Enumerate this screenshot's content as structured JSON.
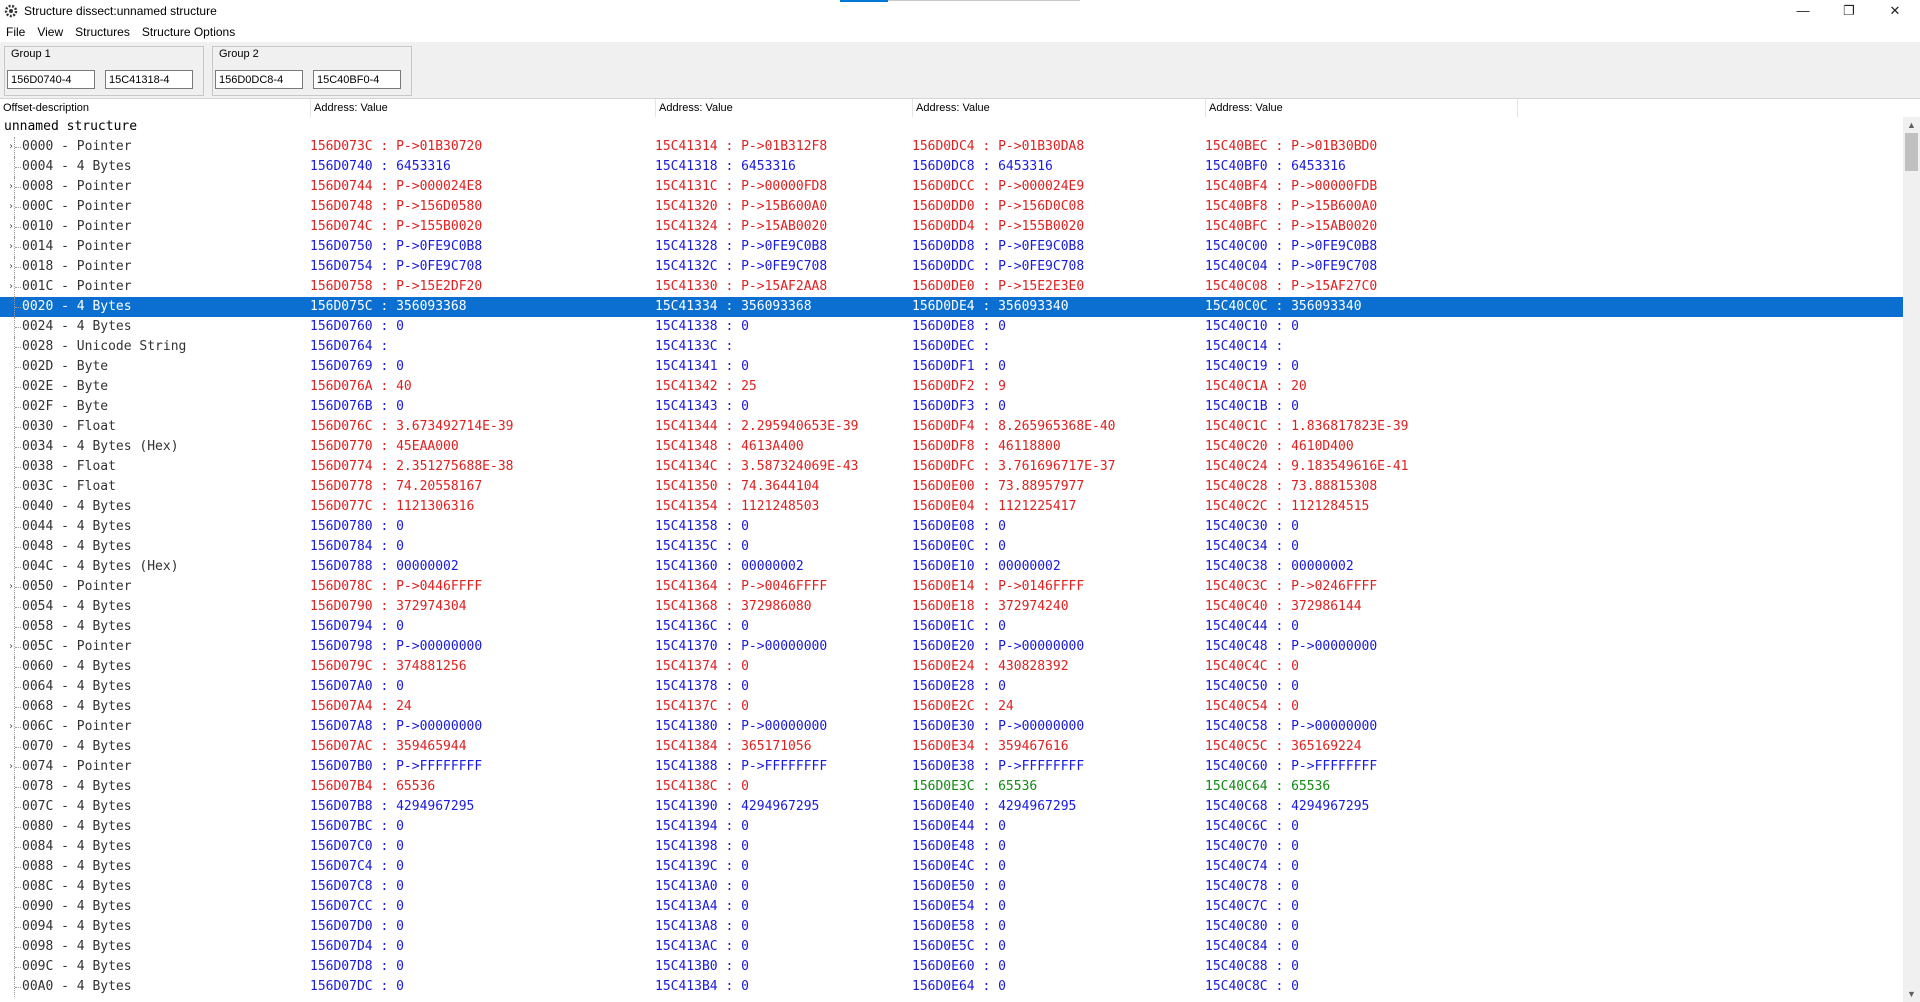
{
  "window": {
    "title": "Structure dissect:unnamed structure",
    "minimize": "—",
    "restore": "❐",
    "close": "✕"
  },
  "menu": [
    "File",
    "View",
    "Structures",
    "Structure Options"
  ],
  "groups": [
    {
      "title": "Group 1",
      "addresses": [
        "156D0740-4",
        "15C41318-4"
      ]
    },
    {
      "title": "Group 2",
      "addresses": [
        "156D0DC8-4",
        "15C40BF0-4"
      ]
    }
  ],
  "columns": [
    "Offset-description",
    "Address: Value",
    "Address: Value",
    "Address: Value",
    "Address: Value"
  ],
  "root_label": "unnamed structure",
  "colors": {
    "red": "#e02020",
    "blue": "#1a1ae0",
    "green": "#128a12",
    "selection": "#0a6fd1"
  },
  "rows": [
    {
      "offset": "0000",
      "type": "Pointer",
      "exp": true,
      "cells": [
        [
          "156D073C",
          "P->01B30720",
          "r"
        ],
        [
          "15C41314",
          "P->01B312F8",
          "r"
        ],
        [
          "156D0DC4",
          "P->01B30DA8",
          "r"
        ],
        [
          "15C40BEC",
          "P->01B30BD0",
          "r"
        ]
      ]
    },
    {
      "offset": "0004",
      "type": "4 Bytes",
      "exp": false,
      "cells": [
        [
          "156D0740",
          "6453316",
          "b"
        ],
        [
          "15C41318",
          "6453316",
          "b"
        ],
        [
          "156D0DC8",
          "6453316",
          "b"
        ],
        [
          "15C40BF0",
          "6453316",
          "b"
        ]
      ]
    },
    {
      "offset": "0008",
      "type": "Pointer",
      "exp": true,
      "cells": [
        [
          "156D0744",
          "P->000024E8",
          "r"
        ],
        [
          "15C4131C",
          "P->00000FD8",
          "r"
        ],
        [
          "156D0DCC",
          "P->000024E9",
          "r"
        ],
        [
          "15C40BF4",
          "P->00000FDB",
          "r"
        ]
      ]
    },
    {
      "offset": "000C",
      "type": "Pointer",
      "exp": true,
      "cells": [
        [
          "156D0748",
          "P->156D0580",
          "r"
        ],
        [
          "15C41320",
          "P->15B600A0",
          "r"
        ],
        [
          "156D0DD0",
          "P->156D0C08",
          "r"
        ],
        [
          "15C40BF8",
          "P->15B600A0",
          "r"
        ]
      ]
    },
    {
      "offset": "0010",
      "type": "Pointer",
      "exp": true,
      "cells": [
        [
          "156D074C",
          "P->155B0020",
          "r"
        ],
        [
          "15C41324",
          "P->15AB0020",
          "r"
        ],
        [
          "156D0DD4",
          "P->155B0020",
          "r"
        ],
        [
          "15C40BFC",
          "P->15AB0020",
          "r"
        ]
      ]
    },
    {
      "offset": "0014",
      "type": "Pointer",
      "exp": true,
      "cells": [
        [
          "156D0750",
          "P->0FE9C0B8",
          "b"
        ],
        [
          "15C41328",
          "P->0FE9C0B8",
          "b"
        ],
        [
          "156D0DD8",
          "P->0FE9C0B8",
          "b"
        ],
        [
          "15C40C00",
          "P->0FE9C0B8",
          "b"
        ]
      ]
    },
    {
      "offset": "0018",
      "type": "Pointer",
      "exp": true,
      "cells": [
        [
          "156D0754",
          "P->0FE9C708",
          "b"
        ],
        [
          "15C4132C",
          "P->0FE9C708",
          "b"
        ],
        [
          "156D0DDC",
          "P->0FE9C708",
          "b"
        ],
        [
          "15C40C04",
          "P->0FE9C708",
          "b"
        ]
      ]
    },
    {
      "offset": "001C",
      "type": "Pointer",
      "exp": true,
      "cells": [
        [
          "156D0758",
          "P->15E2DF20",
          "r"
        ],
        [
          "15C41330",
          "P->15AF2AA8",
          "r"
        ],
        [
          "156D0DE0",
          "P->15E2E3E0",
          "r"
        ],
        [
          "15C40C08",
          "P->15AF27C0",
          "r"
        ]
      ]
    },
    {
      "offset": "0020",
      "type": "4 Bytes",
      "exp": false,
      "selected": true,
      "cells": [
        [
          "156D075C",
          "356093368",
          "r"
        ],
        [
          "15C41334",
          "356093368",
          "r"
        ],
        [
          "156D0DE4",
          "356093340",
          "r"
        ],
        [
          "15C40C0C",
          "356093340",
          "r"
        ]
      ]
    },
    {
      "offset": "0024",
      "type": "4 Bytes",
      "exp": false,
      "cells": [
        [
          "156D0760",
          "0",
          "b"
        ],
        [
          "15C41338",
          "0",
          "b"
        ],
        [
          "156D0DE8",
          "0",
          "b"
        ],
        [
          "15C40C10",
          "0",
          "b"
        ]
      ]
    },
    {
      "offset": "0028",
      "type": "Unicode String",
      "exp": false,
      "cells": [
        [
          "156D0764",
          "",
          "b"
        ],
        [
          "15C4133C",
          "",
          "b"
        ],
        [
          "156D0DEC",
          "",
          "b"
        ],
        [
          "15C40C14",
          "",
          "b"
        ]
      ]
    },
    {
      "offset": "002D",
      "type": "Byte",
      "exp": false,
      "cells": [
        [
          "156D0769",
          "0",
          "b"
        ],
        [
          "15C41341",
          "0",
          "b"
        ],
        [
          "156D0DF1",
          "0",
          "b"
        ],
        [
          "15C40C19",
          "0",
          "b"
        ]
      ]
    },
    {
      "offset": "002E",
      "type": "Byte",
      "exp": false,
      "cells": [
        [
          "156D076A",
          "40",
          "r"
        ],
        [
          "15C41342",
          "25",
          "r"
        ],
        [
          "156D0DF2",
          "9",
          "r"
        ],
        [
          "15C40C1A",
          "20",
          "r"
        ]
      ]
    },
    {
      "offset": "002F",
      "type": "Byte",
      "exp": false,
      "cells": [
        [
          "156D076B",
          "0",
          "b"
        ],
        [
          "15C41343",
          "0",
          "b"
        ],
        [
          "156D0DF3",
          "0",
          "b"
        ],
        [
          "15C40C1B",
          "0",
          "b"
        ]
      ]
    },
    {
      "offset": "0030",
      "type": "Float",
      "exp": false,
      "cells": [
        [
          "156D076C",
          "3.673492714E-39",
          "r"
        ],
        [
          "15C41344",
          "2.295940653E-39",
          "r"
        ],
        [
          "156D0DF4",
          "8.265965368E-40",
          "r"
        ],
        [
          "15C40C1C",
          "1.836817823E-39",
          "r"
        ]
      ]
    },
    {
      "offset": "0034",
      "type": "4 Bytes (Hex)",
      "exp": false,
      "cells": [
        [
          "156D0770",
          "45EAA000",
          "r"
        ],
        [
          "15C41348",
          "4613A400",
          "r"
        ],
        [
          "156D0DF8",
          "46118800",
          "r"
        ],
        [
          "15C40C20",
          "4610D400",
          "r"
        ]
      ]
    },
    {
      "offset": "0038",
      "type": "Float",
      "exp": false,
      "cells": [
        [
          "156D0774",
          "2.351275688E-38",
          "r"
        ],
        [
          "15C4134C",
          "3.587324069E-43",
          "r"
        ],
        [
          "156D0DFC",
          "3.761696717E-37",
          "r"
        ],
        [
          "15C40C24",
          "9.183549616E-41",
          "r"
        ]
      ]
    },
    {
      "offset": "003C",
      "type": "Float",
      "exp": false,
      "cells": [
        [
          "156D0778",
          "74.20558167",
          "r"
        ],
        [
          "15C41350",
          "74.3644104",
          "r"
        ],
        [
          "156D0E00",
          "73.88957977",
          "r"
        ],
        [
          "15C40C28",
          "73.88815308",
          "r"
        ]
      ]
    },
    {
      "offset": "0040",
      "type": "4 Bytes",
      "exp": false,
      "cells": [
        [
          "156D077C",
          "1121306316",
          "r"
        ],
        [
          "15C41354",
          "1121248503",
          "r"
        ],
        [
          "156D0E04",
          "1121225417",
          "r"
        ],
        [
          "15C40C2C",
          "1121284515",
          "r"
        ]
      ]
    },
    {
      "offset": "0044",
      "type": "4 Bytes",
      "exp": false,
      "cells": [
        [
          "156D0780",
          "0",
          "b"
        ],
        [
          "15C41358",
          "0",
          "b"
        ],
        [
          "156D0E08",
          "0",
          "b"
        ],
        [
          "15C40C30",
          "0",
          "b"
        ]
      ]
    },
    {
      "offset": "0048",
      "type": "4 Bytes",
      "exp": false,
      "cells": [
        [
          "156D0784",
          "0",
          "b"
        ],
        [
          "15C4135C",
          "0",
          "b"
        ],
        [
          "156D0E0C",
          "0",
          "b"
        ],
        [
          "15C40C34",
          "0",
          "b"
        ]
      ]
    },
    {
      "offset": "004C",
      "type": "4 Bytes (Hex)",
      "exp": false,
      "cells": [
        [
          "156D0788",
          "00000002",
          "b"
        ],
        [
          "15C41360",
          "00000002",
          "b"
        ],
        [
          "156D0E10",
          "00000002",
          "b"
        ],
        [
          "15C40C38",
          "00000002",
          "b"
        ]
      ]
    },
    {
      "offset": "0050",
      "type": "Pointer",
      "exp": true,
      "cells": [
        [
          "156D078C",
          "P->0446FFFF",
          "r"
        ],
        [
          "15C41364",
          "P->0046FFFF",
          "r"
        ],
        [
          "156D0E14",
          "P->0146FFFF",
          "r"
        ],
        [
          "15C40C3C",
          "P->0246FFFF",
          "r"
        ]
      ]
    },
    {
      "offset": "0054",
      "type": "4 Bytes",
      "exp": false,
      "cells": [
        [
          "156D0790",
          "372974304",
          "r"
        ],
        [
          "15C41368",
          "372986080",
          "r"
        ],
        [
          "156D0E18",
          "372974240",
          "r"
        ],
        [
          "15C40C40",
          "372986144",
          "r"
        ]
      ]
    },
    {
      "offset": "0058",
      "type": "4 Bytes",
      "exp": false,
      "cells": [
        [
          "156D0794",
          "0",
          "b"
        ],
        [
          "15C4136C",
          "0",
          "b"
        ],
        [
          "156D0E1C",
          "0",
          "b"
        ],
        [
          "15C40C44",
          "0",
          "b"
        ]
      ]
    },
    {
      "offset": "005C",
      "type": "Pointer",
      "exp": true,
      "cells": [
        [
          "156D0798",
          "P->00000000",
          "b"
        ],
        [
          "15C41370",
          "P->00000000",
          "b"
        ],
        [
          "156D0E20",
          "P->00000000",
          "b"
        ],
        [
          "15C40C48",
          "P->00000000",
          "b"
        ]
      ]
    },
    {
      "offset": "0060",
      "type": "4 Bytes",
      "exp": false,
      "cells": [
        [
          "156D079C",
          "374881256",
          "r"
        ],
        [
          "15C41374",
          "0",
          "r"
        ],
        [
          "156D0E24",
          "430828392",
          "r"
        ],
        [
          "15C40C4C",
          "0",
          "r"
        ]
      ]
    },
    {
      "offset": "0064",
      "type": "4 Bytes",
      "exp": false,
      "cells": [
        [
          "156D07A0",
          "0",
          "b"
        ],
        [
          "15C41378",
          "0",
          "b"
        ],
        [
          "156D0E28",
          "0",
          "b"
        ],
        [
          "15C40C50",
          "0",
          "b"
        ]
      ]
    },
    {
      "offset": "0068",
      "type": "4 Bytes",
      "exp": false,
      "cells": [
        [
          "156D07A4",
          "24",
          "r"
        ],
        [
          "15C4137C",
          "0",
          "r"
        ],
        [
          "156D0E2C",
          "24",
          "r"
        ],
        [
          "15C40C54",
          "0",
          "r"
        ]
      ]
    },
    {
      "offset": "006C",
      "type": "Pointer",
      "exp": true,
      "cells": [
        [
          "156D07A8",
          "P->00000000",
          "b"
        ],
        [
          "15C41380",
          "P->00000000",
          "b"
        ],
        [
          "156D0E30",
          "P->00000000",
          "b"
        ],
        [
          "15C40C58",
          "P->00000000",
          "b"
        ]
      ]
    },
    {
      "offset": "0070",
      "type": "4 Bytes",
      "exp": false,
      "cells": [
        [
          "156D07AC",
          "359465944",
          "r"
        ],
        [
          "15C41384",
          "365171056",
          "r"
        ],
        [
          "156D0E34",
          "359467616",
          "r"
        ],
        [
          "15C40C5C",
          "365169224",
          "r"
        ]
      ]
    },
    {
      "offset": "0074",
      "type": "Pointer",
      "exp": true,
      "cells": [
        [
          "156D07B0",
          "P->FFFFFFFF",
          "b"
        ],
        [
          "15C41388",
          "P->FFFFFFFF",
          "b"
        ],
        [
          "156D0E38",
          "P->FFFFFFFF",
          "b"
        ],
        [
          "15C40C60",
          "P->FFFFFFFF",
          "b"
        ]
      ]
    },
    {
      "offset": "0078",
      "type": "4 Bytes",
      "exp": false,
      "cells": [
        [
          "156D07B4",
          "65536",
          "r"
        ],
        [
          "15C4138C",
          "0",
          "r"
        ],
        [
          "156D0E3C",
          "65536",
          "g"
        ],
        [
          "15C40C64",
          "65536",
          "g"
        ]
      ]
    },
    {
      "offset": "007C",
      "type": "4 Bytes",
      "exp": false,
      "cells": [
        [
          "156D07B8",
          "4294967295",
          "b"
        ],
        [
          "15C41390",
          "4294967295",
          "b"
        ],
        [
          "156D0E40",
          "4294967295",
          "b"
        ],
        [
          "15C40C68",
          "4294967295",
          "b"
        ]
      ]
    },
    {
      "offset": "0080",
      "type": "4 Bytes",
      "exp": false,
      "cells": [
        [
          "156D07BC",
          "0",
          "b"
        ],
        [
          "15C41394",
          "0",
          "b"
        ],
        [
          "156D0E44",
          "0",
          "b"
        ],
        [
          "15C40C6C",
          "0",
          "b"
        ]
      ]
    },
    {
      "offset": "0084",
      "type": "4 Bytes",
      "exp": false,
      "cells": [
        [
          "156D07C0",
          "0",
          "b"
        ],
        [
          "15C41398",
          "0",
          "b"
        ],
        [
          "156D0E48",
          "0",
          "b"
        ],
        [
          "15C40C70",
          "0",
          "b"
        ]
      ]
    },
    {
      "offset": "0088",
      "type": "4 Bytes",
      "exp": false,
      "cells": [
        [
          "156D07C4",
          "0",
          "b"
        ],
        [
          "15C4139C",
          "0",
          "b"
        ],
        [
          "156D0E4C",
          "0",
          "b"
        ],
        [
          "15C40C74",
          "0",
          "b"
        ]
      ]
    },
    {
      "offset": "008C",
      "type": "4 Bytes",
      "exp": false,
      "cells": [
        [
          "156D07C8",
          "0",
          "b"
        ],
        [
          "15C413A0",
          "0",
          "b"
        ],
        [
          "156D0E50",
          "0",
          "b"
        ],
        [
          "15C40C78",
          "0",
          "b"
        ]
      ]
    },
    {
      "offset": "0090",
      "type": "4 Bytes",
      "exp": false,
      "cells": [
        [
          "156D07CC",
          "0",
          "b"
        ],
        [
          "15C413A4",
          "0",
          "b"
        ],
        [
          "156D0E54",
          "0",
          "b"
        ],
        [
          "15C40C7C",
          "0",
          "b"
        ]
      ]
    },
    {
      "offset": "0094",
      "type": "4 Bytes",
      "exp": false,
      "cells": [
        [
          "156D07D0",
          "0",
          "b"
        ],
        [
          "15C413A8",
          "0",
          "b"
        ],
        [
          "156D0E58",
          "0",
          "b"
        ],
        [
          "15C40C80",
          "0",
          "b"
        ]
      ]
    },
    {
      "offset": "0098",
      "type": "4 Bytes",
      "exp": false,
      "cells": [
        [
          "156D07D4",
          "0",
          "b"
        ],
        [
          "15C413AC",
          "0",
          "b"
        ],
        [
          "156D0E5C",
          "0",
          "b"
        ],
        [
          "15C40C84",
          "0",
          "b"
        ]
      ]
    },
    {
      "offset": "009C",
      "type": "4 Bytes",
      "exp": false,
      "cells": [
        [
          "156D07D8",
          "0",
          "b"
        ],
        [
          "15C413B0",
          "0",
          "b"
        ],
        [
          "156D0E60",
          "0",
          "b"
        ],
        [
          "15C40C88",
          "0",
          "b"
        ]
      ]
    },
    {
      "offset": "00A0",
      "type": "4 Bytes",
      "exp": false,
      "cells": [
        [
          "156D07DC",
          "0",
          "b"
        ],
        [
          "15C413B4",
          "0",
          "b"
        ],
        [
          "156D0E64",
          "0",
          "b"
        ],
        [
          "15C40C8C",
          "0",
          "b"
        ]
      ]
    }
  ]
}
